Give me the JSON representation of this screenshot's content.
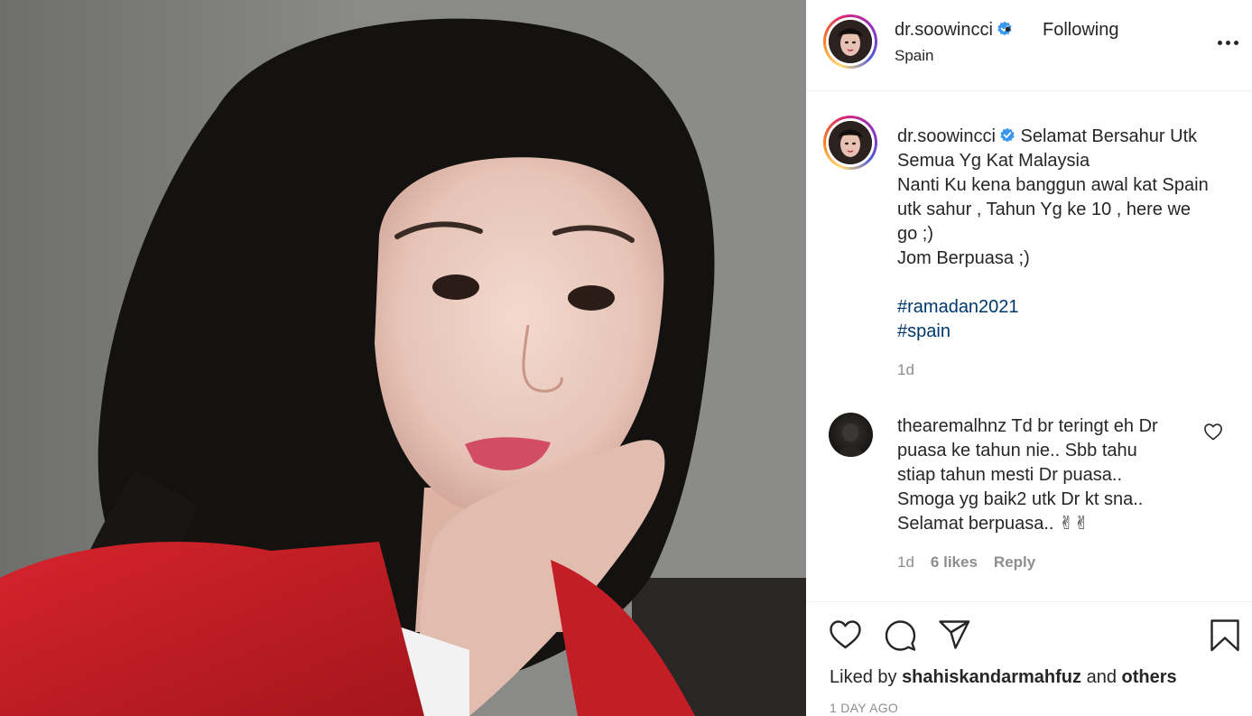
{
  "post": {
    "username": "dr.soowincci",
    "dot": "•",
    "follow_status": "Following",
    "location": "Spain",
    "caption_lines": [
      "Selamat Bersahur Utk",
      "Semua Yg Kat Malaysia",
      "Nanti Ku kena banggun awal kat Spain",
      "utk sahur , Tahun Yg ke 10 , here we",
      "go ;)",
      "Jom Berpuasa ;)"
    ],
    "hashtags": [
      "#ramadan2021",
      "#spain"
    ],
    "caption_time": "1d"
  },
  "comment": {
    "username": "thearemalhnz",
    "lines": [
      "Td br teringt eh Dr",
      "puasa ke tahun nie.. Sbb tahu",
      "stiap tahun mesti Dr puasa..",
      "Smoga yg baik2 utk Dr kt sna..",
      "Selamat berpuasa.. ✌✌"
    ],
    "time": "1d",
    "likes": "6 likes",
    "reply_label": "Reply"
  },
  "footer": {
    "liked_by_prefix": "Liked by",
    "liked_by_user": "shahiskandarmahfuz",
    "liked_by_and": "and",
    "liked_by_others": "others",
    "posted_ago": "1 DAY AGO"
  },
  "colors": {
    "text": "#262626",
    "muted": "#8e8e8e",
    "hashtag": "#00376b",
    "verified": "#3897f0",
    "divider": "#efefef"
  },
  "icons": [
    "verified-badge-icon",
    "more-options-icon",
    "heart-icon",
    "comment-icon",
    "share-icon",
    "bookmark-icon"
  ]
}
